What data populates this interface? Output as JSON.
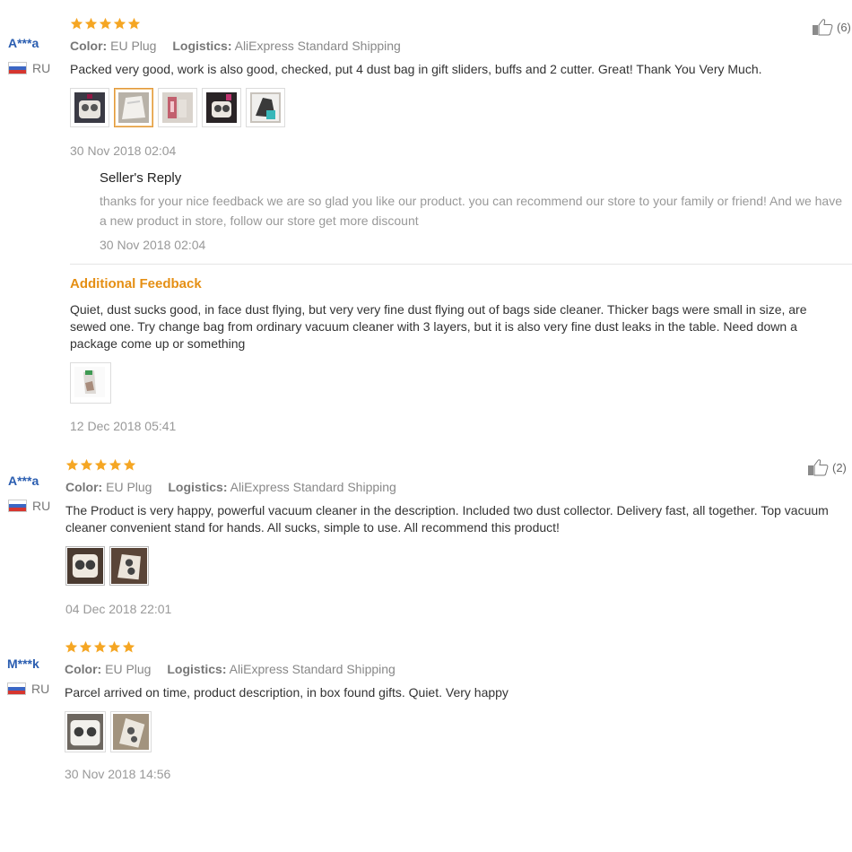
{
  "reviews": [
    {
      "user": "A***a",
      "country": "RU",
      "rating": 5,
      "color_label": "Color:",
      "color_value": "EU Plug",
      "logistics_label": "Logistics:",
      "logistics_value": "AliExpress Standard Shipping",
      "helpful_count": "(6)",
      "text": "Packed very good, work is also good, checked, put 4 dust bag in gift sliders, buffs and 2 cutter. Great! Thank You Very Much.",
      "date": "30 Nov 2018 02:04",
      "seller_reply_title": "Seller's Reply",
      "seller_reply_text": "thanks for your nice feedback we are so glad you like our product. you can recommend our store to your family or friend! And we have a new product in store, follow our store get more discount",
      "seller_reply_date": "30 Nov 2018 02:04",
      "additional_title": "Additional Feedback",
      "additional_text": "Quiet, dust sucks good, in face dust flying, but very very fine dust flying out of bags side cleaner. Thicker bags were small in size, are sewed one. Try change bag from ordinary vacuum cleaner with 3 layers, but it is also very fine dust leaks in the table. Need down a package come up or something",
      "additional_date": "12 Dec 2018 05:41"
    },
    {
      "user": "A***a",
      "country": "RU",
      "rating": 5,
      "color_label": "Color:",
      "color_value": "EU Plug",
      "logistics_label": "Logistics:",
      "logistics_value": "AliExpress Standard Shipping",
      "helpful_count": "(2)",
      "text": "The Product is very happy, powerful vacuum cleaner in the description. Included two dust collector. Delivery fast, all together. Top vacuum cleaner convenient stand for hands. All sucks, simple to use. All recommend this product!",
      "date": "04 Dec 2018 22:01"
    },
    {
      "user": "M***k",
      "country": "RU",
      "rating": 5,
      "color_label": "Color:",
      "color_value": "EU Plug",
      "logistics_label": "Logistics:",
      "logistics_value": "AliExpress Standard Shipping",
      "text": "Parcel arrived on time, product description, in box found gifts. Quiet. Very happy",
      "date": "30 Nov 2018 14:56"
    }
  ],
  "colors": {
    "star": "#f5a623",
    "username": "#2a5db0",
    "additional_title": "#e58f14",
    "selected_thumb_border": "#e39a3b"
  },
  "icons": {
    "star": "star-icon",
    "thumbs_up": "thumbs-up-icon",
    "flag": "russia-flag-icon"
  }
}
